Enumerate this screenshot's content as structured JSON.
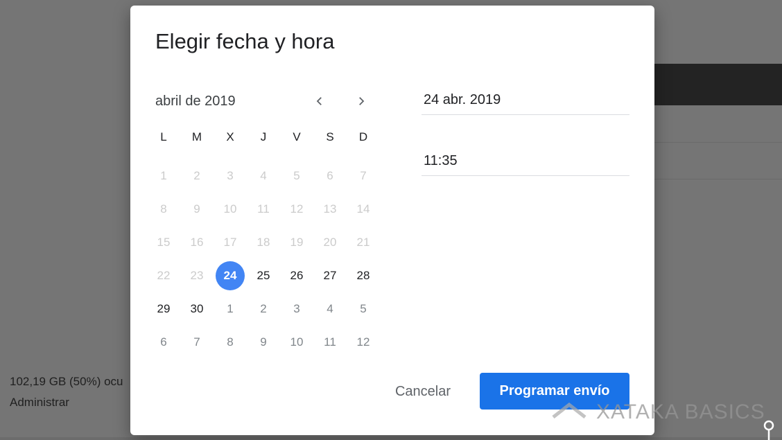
{
  "background": {
    "storage_text": "102,19 GB (50%) ocu",
    "manage_link": "Administrar"
  },
  "dialog": {
    "title": "Elegir fecha y hora",
    "month_label": "abril de 2019",
    "weekdays": [
      "L",
      "M",
      "X",
      "J",
      "V",
      "S",
      "D"
    ],
    "weeks": [
      [
        {
          "d": "1",
          "s": "disabled"
        },
        {
          "d": "2",
          "s": "disabled"
        },
        {
          "d": "3",
          "s": "disabled"
        },
        {
          "d": "4",
          "s": "disabled"
        },
        {
          "d": "5",
          "s": "disabled"
        },
        {
          "d": "6",
          "s": "disabled"
        },
        {
          "d": "7",
          "s": "disabled"
        }
      ],
      [
        {
          "d": "8",
          "s": "disabled"
        },
        {
          "d": "9",
          "s": "disabled"
        },
        {
          "d": "10",
          "s": "disabled"
        },
        {
          "d": "11",
          "s": "disabled"
        },
        {
          "d": "12",
          "s": "disabled"
        },
        {
          "d": "13",
          "s": "disabled"
        },
        {
          "d": "14",
          "s": "disabled"
        }
      ],
      [
        {
          "d": "15",
          "s": "disabled"
        },
        {
          "d": "16",
          "s": "disabled"
        },
        {
          "d": "17",
          "s": "disabled"
        },
        {
          "d": "18",
          "s": "disabled"
        },
        {
          "d": "19",
          "s": "disabled"
        },
        {
          "d": "20",
          "s": "disabled"
        },
        {
          "d": "21",
          "s": "disabled"
        }
      ],
      [
        {
          "d": "22",
          "s": "disabled"
        },
        {
          "d": "23",
          "s": "disabled"
        },
        {
          "d": "24",
          "s": "selected"
        },
        {
          "d": "25",
          "s": "active"
        },
        {
          "d": "26",
          "s": "active"
        },
        {
          "d": "27",
          "s": "active"
        },
        {
          "d": "28",
          "s": "active"
        }
      ],
      [
        {
          "d": "29",
          "s": "active"
        },
        {
          "d": "30",
          "s": "active"
        },
        {
          "d": "1",
          "s": "other"
        },
        {
          "d": "2",
          "s": "other"
        },
        {
          "d": "3",
          "s": "other"
        },
        {
          "d": "4",
          "s": "other"
        },
        {
          "d": "5",
          "s": "other"
        }
      ],
      [
        {
          "d": "6",
          "s": "other"
        },
        {
          "d": "7",
          "s": "other"
        },
        {
          "d": "8",
          "s": "other"
        },
        {
          "d": "9",
          "s": "other"
        },
        {
          "d": "10",
          "s": "other"
        },
        {
          "d": "11",
          "s": "other"
        },
        {
          "d": "12",
          "s": "other"
        }
      ]
    ],
    "date_value": "24 abr. 2019",
    "time_value": "11:35",
    "cancel_label": "Cancelar",
    "schedule_label": "Programar envío"
  },
  "watermark": "XATAKA BASICS",
  "colors": {
    "accent": "#1a73e8",
    "selected_day": "#4285f4",
    "disabled_day": "#cbcbcb"
  },
  "icons": {
    "prev": "chevron-left-icon",
    "next": "chevron-right-icon"
  }
}
